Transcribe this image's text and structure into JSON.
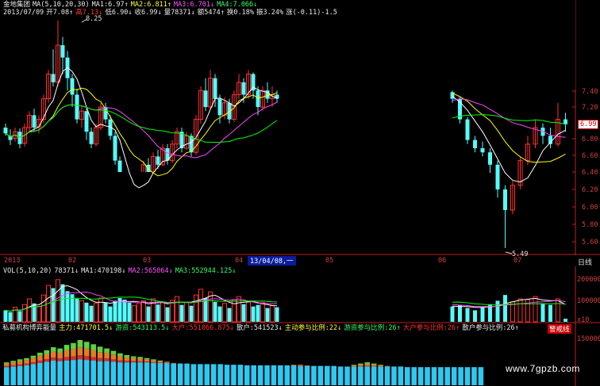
{
  "header": {
    "stock_name": "金地集团",
    "ma_label": "MA(5,10,20,30)",
    "ma1": "MA1:6.97↑",
    "ma2": "MA2:6.811↑",
    "ma3": "MA3:6.701↓",
    "ma4": "MA4:7.066↓",
    "date": "2013/07/09",
    "open": "开7.08↑",
    "high": "高7.13↓",
    "low": "低6.90↓",
    "close": "收6.99↓",
    "volume": "量78371↓",
    "amount": "额5474↑",
    "change": "换0.18%",
    "amplitude": "振3.24%",
    "rise": "涨(-0.11)-1.5"
  },
  "price_axis": [
    "7.40",
    "7.20",
    "7.00",
    "6.80",
    "6.60",
    "6.40",
    "6.20",
    "6.00",
    "5.80",
    "5.60"
  ],
  "last_price": "6.99",
  "high_mark": "8.25",
  "low_mark": "5.49",
  "time_axis": [
    "2013",
    "02",
    "03",
    "04",
    "05",
    "06",
    "07"
  ],
  "crosshair_date": "13/04/08,一",
  "period_button": "日线",
  "vol_header": {
    "label": "VOL(5,10,20)",
    "vol": "78371↓",
    "ma1": "MA1:470198↓",
    "ma2": "MA2:565064↓",
    "ma3": "MA3:552944.125↓"
  },
  "vol_axis": [
    "200000",
    "100000",
    "x10"
  ],
  "indicator_header": {
    "name": "私募机构博弈能量",
    "main": "主力:471701.5↓",
    "retail_free": "游资:543113.5↓",
    "big": "大户:551066.875↓",
    "small": "散户:541523↓",
    "main_ratio": "主动参与比例:22↓",
    "free_ratio": "游资参与比例:26↑",
    "big_ratio": "大户参与比例:26↑",
    "small_ratio": "散户参与比例:26↑",
    "dropdown": "警戒线"
  },
  "ind_axis": [
    "150000"
  ],
  "watermark": "www.7gpzb.com",
  "colors": {
    "up": "#ff3030",
    "down": "#54fcfc",
    "ma1": "#ffffff",
    "ma2": "#ffff00",
    "ma3": "#ff44ff",
    "ma4": "#00ff00",
    "axis": "#c02020"
  },
  "candles": [
    {
      "o": 6.95,
      "c": 6.88,
      "h": 7.0,
      "l": 6.85
    },
    {
      "o": 6.85,
      "c": 6.8,
      "h": 6.93,
      "l": 6.74
    },
    {
      "o": 6.82,
      "c": 6.9,
      "h": 6.95,
      "l": 6.78
    },
    {
      "o": 6.9,
      "c": 6.75,
      "h": 6.94,
      "l": 6.7
    },
    {
      "o": 6.76,
      "c": 6.95,
      "h": 7.0,
      "l": 6.72
    },
    {
      "o": 6.95,
      "c": 7.1,
      "h": 7.15,
      "l": 6.9
    },
    {
      "o": 7.1,
      "c": 6.95,
      "h": 7.18,
      "l": 6.9
    },
    {
      "o": 6.96,
      "c": 7.05,
      "h": 7.1,
      "l": 6.88
    },
    {
      "o": 7.05,
      "c": 7.3,
      "h": 7.35,
      "l": 7.0
    },
    {
      "o": 7.3,
      "c": 7.6,
      "h": 7.65,
      "l": 7.25
    },
    {
      "o": 7.6,
      "c": 7.5,
      "h": 7.9,
      "l": 7.45
    },
    {
      "o": 7.5,
      "c": 7.95,
      "h": 8.25,
      "l": 7.45
    },
    {
      "o": 7.95,
      "c": 7.8,
      "h": 8.05,
      "l": 7.6
    },
    {
      "o": 7.8,
      "c": 7.55,
      "h": 7.88,
      "l": 7.4
    },
    {
      "o": 7.55,
      "c": 7.35,
      "h": 7.6,
      "l": 7.2
    },
    {
      "o": 7.35,
      "c": 7.05,
      "h": 7.42,
      "l": 7.0
    },
    {
      "o": 7.05,
      "c": 7.15,
      "h": 7.22,
      "l": 6.95
    },
    {
      "o": 7.15,
      "c": 6.9,
      "h": 7.18,
      "l": 6.8
    },
    {
      "o": 6.9,
      "c": 6.75,
      "h": 6.95,
      "l": 6.7
    },
    {
      "o": 6.75,
      "c": 6.95,
      "h": 7.0,
      "l": 6.72
    },
    {
      "o": 6.95,
      "c": 7.2,
      "h": 7.25,
      "l": 6.92
    },
    {
      "o": 7.2,
      "c": 7.05,
      "h": 7.25,
      "l": 7.0
    },
    {
      "o": 7.05,
      "c": 6.85,
      "h": 7.1,
      "l": 6.8
    },
    {
      "o": 6.85,
      "c": 6.55,
      "h": 6.9,
      "l": 6.5
    },
    {
      "o": 6.55,
      "c": 6.35,
      "h": 6.6,
      "l": 6.3
    },
    {
      "o": 6.35,
      "c": 6.2,
      "h": 6.4,
      "l": 6.1
    },
    {
      "o": 6.2,
      "c": 6.05,
      "h": 6.28,
      "l": 5.98
    },
    {
      "o": 6.05,
      "c": 6.15,
      "h": 6.2,
      "l": 5.95
    },
    {
      "o": 6.15,
      "c": 6.35,
      "h": 6.4,
      "l": 6.1
    },
    {
      "o": 6.35,
      "c": 6.5,
      "h": 6.55,
      "l": 6.3
    },
    {
      "o": 6.5,
      "c": 6.4,
      "h": 6.58,
      "l": 6.35
    },
    {
      "o": 6.4,
      "c": 6.6,
      "h": 6.65,
      "l": 6.38
    },
    {
      "o": 6.6,
      "c": 6.5,
      "h": 6.68,
      "l": 6.45
    },
    {
      "o": 6.5,
      "c": 6.7,
      "h": 6.75,
      "l": 6.48
    },
    {
      "o": 6.7,
      "c": 6.55,
      "h": 6.75,
      "l": 6.5
    },
    {
      "o": 6.55,
      "c": 6.75,
      "h": 6.8,
      "l": 6.52
    },
    {
      "o": 6.75,
      "c": 6.9,
      "h": 6.95,
      "l": 6.7
    },
    {
      "o": 6.9,
      "c": 6.7,
      "h": 6.95,
      "l": 6.65
    },
    {
      "o": 6.7,
      "c": 6.85,
      "h": 6.9,
      "l": 6.68
    },
    {
      "o": 6.85,
      "c": 6.65,
      "h": 6.88,
      "l": 6.6
    },
    {
      "o": 6.65,
      "c": 7.05,
      "h": 7.1,
      "l": 6.62
    },
    {
      "o": 7.05,
      "c": 7.4,
      "h": 7.45,
      "l": 7.0
    },
    {
      "o": 7.4,
      "c": 7.2,
      "h": 7.55,
      "l": 7.15
    },
    {
      "o": 7.2,
      "c": 7.55,
      "h": 7.65,
      "l": 7.18
    },
    {
      "o": 7.55,
      "c": 7.3,
      "h": 7.6,
      "l": 7.2
    },
    {
      "o": 7.3,
      "c": 7.1,
      "h": 7.35,
      "l": 7.0
    },
    {
      "o": 7.1,
      "c": 7.25,
      "h": 7.32,
      "l": 7.05
    },
    {
      "o": 7.25,
      "c": 7.05,
      "h": 7.3,
      "l": 7.0
    },
    {
      "o": 7.05,
      "c": 7.35,
      "h": 7.4,
      "l": 7.02
    },
    {
      "o": 7.35,
      "c": 7.5,
      "h": 7.6,
      "l": 7.3
    },
    {
      "o": 7.5,
      "c": 7.35,
      "h": 7.55,
      "l": 7.25
    },
    {
      "o": 7.35,
      "c": 7.6,
      "h": 7.65,
      "l": 7.3
    },
    {
      "o": 7.6,
      "c": 7.4,
      "h": 7.62,
      "l": 7.3
    },
    {
      "o": 7.4,
      "c": 7.2,
      "h": 7.45,
      "l": 7.1
    },
    {
      "o": 7.2,
      "c": 7.4,
      "h": 7.45,
      "l": 7.15
    },
    {
      "o": 7.4,
      "c": 7.3,
      "h": 7.5,
      "l": 7.25
    },
    {
      "o": 7.3,
      "c": 7.35,
      "h": 7.45,
      "l": 7.2
    },
    {
      "o": 7.35,
      "c": 7.3,
      "h": 7.4,
      "l": 7.25
    },
    {
      "o": 7.38,
      "c": 7.3,
      "h": 7.4,
      "l": 7.25
    },
    {
      "o": 7.3,
      "c": 7.05,
      "h": 7.32,
      "l": 7.0
    },
    {
      "o": 7.05,
      "c": 6.8,
      "h": 7.08,
      "l": 6.75
    },
    {
      "o": 6.8,
      "c": 6.7,
      "h": 6.85,
      "l": 6.65
    },
    {
      "o": 6.7,
      "c": 6.65,
      "h": 6.78,
      "l": 6.6
    },
    {
      "o": 6.65,
      "c": 6.5,
      "h": 6.7,
      "l": 6.4
    },
    {
      "o": 6.5,
      "c": 6.2,
      "h": 6.55,
      "l": 6.1
    },
    {
      "o": 6.2,
      "c": 5.95,
      "h": 6.25,
      "l": 5.49
    },
    {
      "o": 5.95,
      "c": 6.25,
      "h": 6.3,
      "l": 5.9
    },
    {
      "o": 6.25,
      "c": 6.55,
      "h": 6.6,
      "l": 6.2
    },
    {
      "o": 6.55,
      "c": 6.75,
      "h": 6.85,
      "l": 6.5
    },
    {
      "o": 6.75,
      "c": 6.95,
      "h": 7.05,
      "l": 6.7
    },
    {
      "o": 6.95,
      "c": 6.85,
      "h": 7.0,
      "l": 6.75
    },
    {
      "o": 6.85,
      "c": 6.75,
      "h": 6.95,
      "l": 6.7
    },
    {
      "o": 6.75,
      "c": 7.05,
      "h": 7.25,
      "l": 6.72
    },
    {
      "o": 7.05,
      "c": 6.99,
      "h": 7.13,
      "l": 6.9
    }
  ],
  "volumes": [
    30,
    25,
    38,
    28,
    45,
    60,
    48,
    40,
    70,
    95,
    88,
    110,
    98,
    80,
    72,
    60,
    55,
    50,
    42,
    48,
    62,
    50,
    40,
    55,
    62,
    58,
    50,
    42,
    48,
    55,
    40,
    60,
    45,
    52,
    38,
    56,
    66,
    44,
    50,
    42,
    70,
    85,
    62,
    78,
    52,
    40,
    48,
    36,
    58,
    66,
    46,
    54,
    40,
    44,
    50,
    36,
    42,
    38,
    40,
    44,
    36,
    30,
    38,
    46,
    55,
    70,
    52,
    60,
    58,
    66,
    48,
    44,
    60,
    8
  ],
  "indicator": [
    {
      "b": 60,
      "o": 12,
      "g": 4
    },
    {
      "b": 62,
      "o": 14,
      "g": 5
    },
    {
      "b": 64,
      "o": 16,
      "g": 6
    },
    {
      "b": 66,
      "o": 18,
      "g": 6
    },
    {
      "b": 70,
      "o": 20,
      "g": 8
    },
    {
      "b": 74,
      "o": 24,
      "g": 10
    },
    {
      "b": 78,
      "o": 26,
      "g": 12
    },
    {
      "b": 82,
      "o": 30,
      "g": 14
    },
    {
      "b": 80,
      "o": 28,
      "g": 14
    },
    {
      "b": 82,
      "o": 34,
      "g": 18
    },
    {
      "b": 84,
      "o": 36,
      "g": 20
    },
    {
      "b": 86,
      "o": 40,
      "g": 24
    },
    {
      "b": 84,
      "o": 38,
      "g": 22
    },
    {
      "b": 82,
      "o": 34,
      "g": 20
    },
    {
      "b": 80,
      "o": 30,
      "g": 18
    },
    {
      "b": 80,
      "o": 28,
      "g": 14
    },
    {
      "b": 78,
      "o": 24,
      "g": 12
    },
    {
      "b": 76,
      "o": 20,
      "g": 10
    },
    {
      "b": 76,
      "o": 16,
      "g": 8
    },
    {
      "b": 76,
      "o": 14,
      "g": 6
    },
    {
      "b": 76,
      "o": 12,
      "g": 6
    },
    {
      "b": 76,
      "o": 10,
      "g": 4
    },
    {
      "b": 74,
      "o": 8,
      "g": 4
    },
    {
      "b": 74,
      "o": 6,
      "g": 2
    },
    {
      "b": 74,
      "o": 4,
      "g": 0
    },
    {
      "b": 72,
      "o": 2,
      "g": 0
    },
    {
      "b": 72,
      "o": 0,
      "g": 0
    },
    {
      "b": 72,
      "o": 0,
      "g": 0
    },
    {
      "b": 70,
      "o": 0,
      "g": 0
    },
    {
      "b": 70,
      "o": 0,
      "g": 0
    },
    {
      "b": 70,
      "o": 0,
      "g": 0
    },
    {
      "b": 70,
      "o": 0,
      "g": 0
    },
    {
      "b": 70,
      "o": 0,
      "g": 0
    },
    {
      "b": 68,
      "o": 0,
      "g": 0
    },
    {
      "b": 68,
      "o": 0,
      "g": 0
    },
    {
      "b": 68,
      "o": 0,
      "g": 0
    },
    {
      "b": 66,
      "o": 0,
      "g": 0
    },
    {
      "b": 66,
      "o": 0,
      "g": 0
    },
    {
      "b": 66,
      "o": 0,
      "g": 0
    },
    {
      "b": 66,
      "o": 0,
      "g": 0
    },
    {
      "b": 66,
      "o": 0,
      "g": 0
    },
    {
      "b": 66,
      "o": 0,
      "g": 0
    },
    {
      "b": 66,
      "o": 0,
      "g": 0
    },
    {
      "b": 66,
      "o": 2,
      "g": 0
    },
    {
      "b": 64,
      "o": 4,
      "g": 0
    },
    {
      "b": 64,
      "o": 2,
      "g": 0
    },
    {
      "b": 64,
      "o": 0,
      "g": 0
    },
    {
      "b": 64,
      "o": 0,
      "g": 0
    },
    {
      "b": 64,
      "o": 0,
      "g": 0
    },
    {
      "b": 64,
      "o": 0,
      "g": 0
    },
    {
      "b": 62,
      "o": 0,
      "g": 0
    },
    {
      "b": 62,
      "o": 0,
      "g": 0
    },
    {
      "b": 62,
      "o": 4,
      "g": 2
    },
    {
      "b": 62,
      "o": 6,
      "g": 4
    },
    {
      "b": 62,
      "o": 8,
      "g": 6
    },
    {
      "b": 62,
      "o": 6,
      "g": 4
    },
    {
      "b": 62,
      "o": 4,
      "g": 2
    },
    {
      "b": 62,
      "o": 2,
      "g": 0
    },
    {
      "b": 62,
      "o": 0,
      "g": 0
    },
    {
      "b": 62,
      "o": 0,
      "g": 0
    },
    {
      "b": 60,
      "o": 0,
      "g": 0
    },
    {
      "b": 60,
      "o": 0,
      "g": 0
    },
    {
      "b": 60,
      "o": 0,
      "g": 0
    },
    {
      "b": 60,
      "o": 0,
      "g": 0
    },
    {
      "b": 60,
      "o": 0,
      "g": 0
    },
    {
      "b": 60,
      "o": 0,
      "g": 0
    },
    {
      "b": 60,
      "o": 0,
      "g": 0
    },
    {
      "b": 60,
      "o": 0,
      "g": 0
    },
    {
      "b": 60,
      "o": 0,
      "g": 0
    },
    {
      "b": 60,
      "o": 0,
      "g": 0
    },
    {
      "b": 60,
      "o": 0,
      "g": 0
    },
    {
      "b": 60,
      "o": 0,
      "g": 0
    }
  ]
}
